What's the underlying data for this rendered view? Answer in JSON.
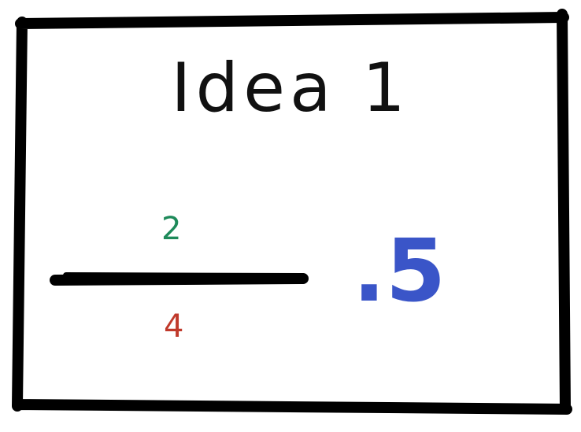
{
  "title": "Idea 1",
  "fraction": {
    "numerator": "2",
    "denominator": "4"
  },
  "result": ".5",
  "colors": {
    "border": "#000000",
    "title": "#111111",
    "numerator": "#1e8a5a",
    "denominator": "#c0392b",
    "result": "#3a55c8"
  }
}
